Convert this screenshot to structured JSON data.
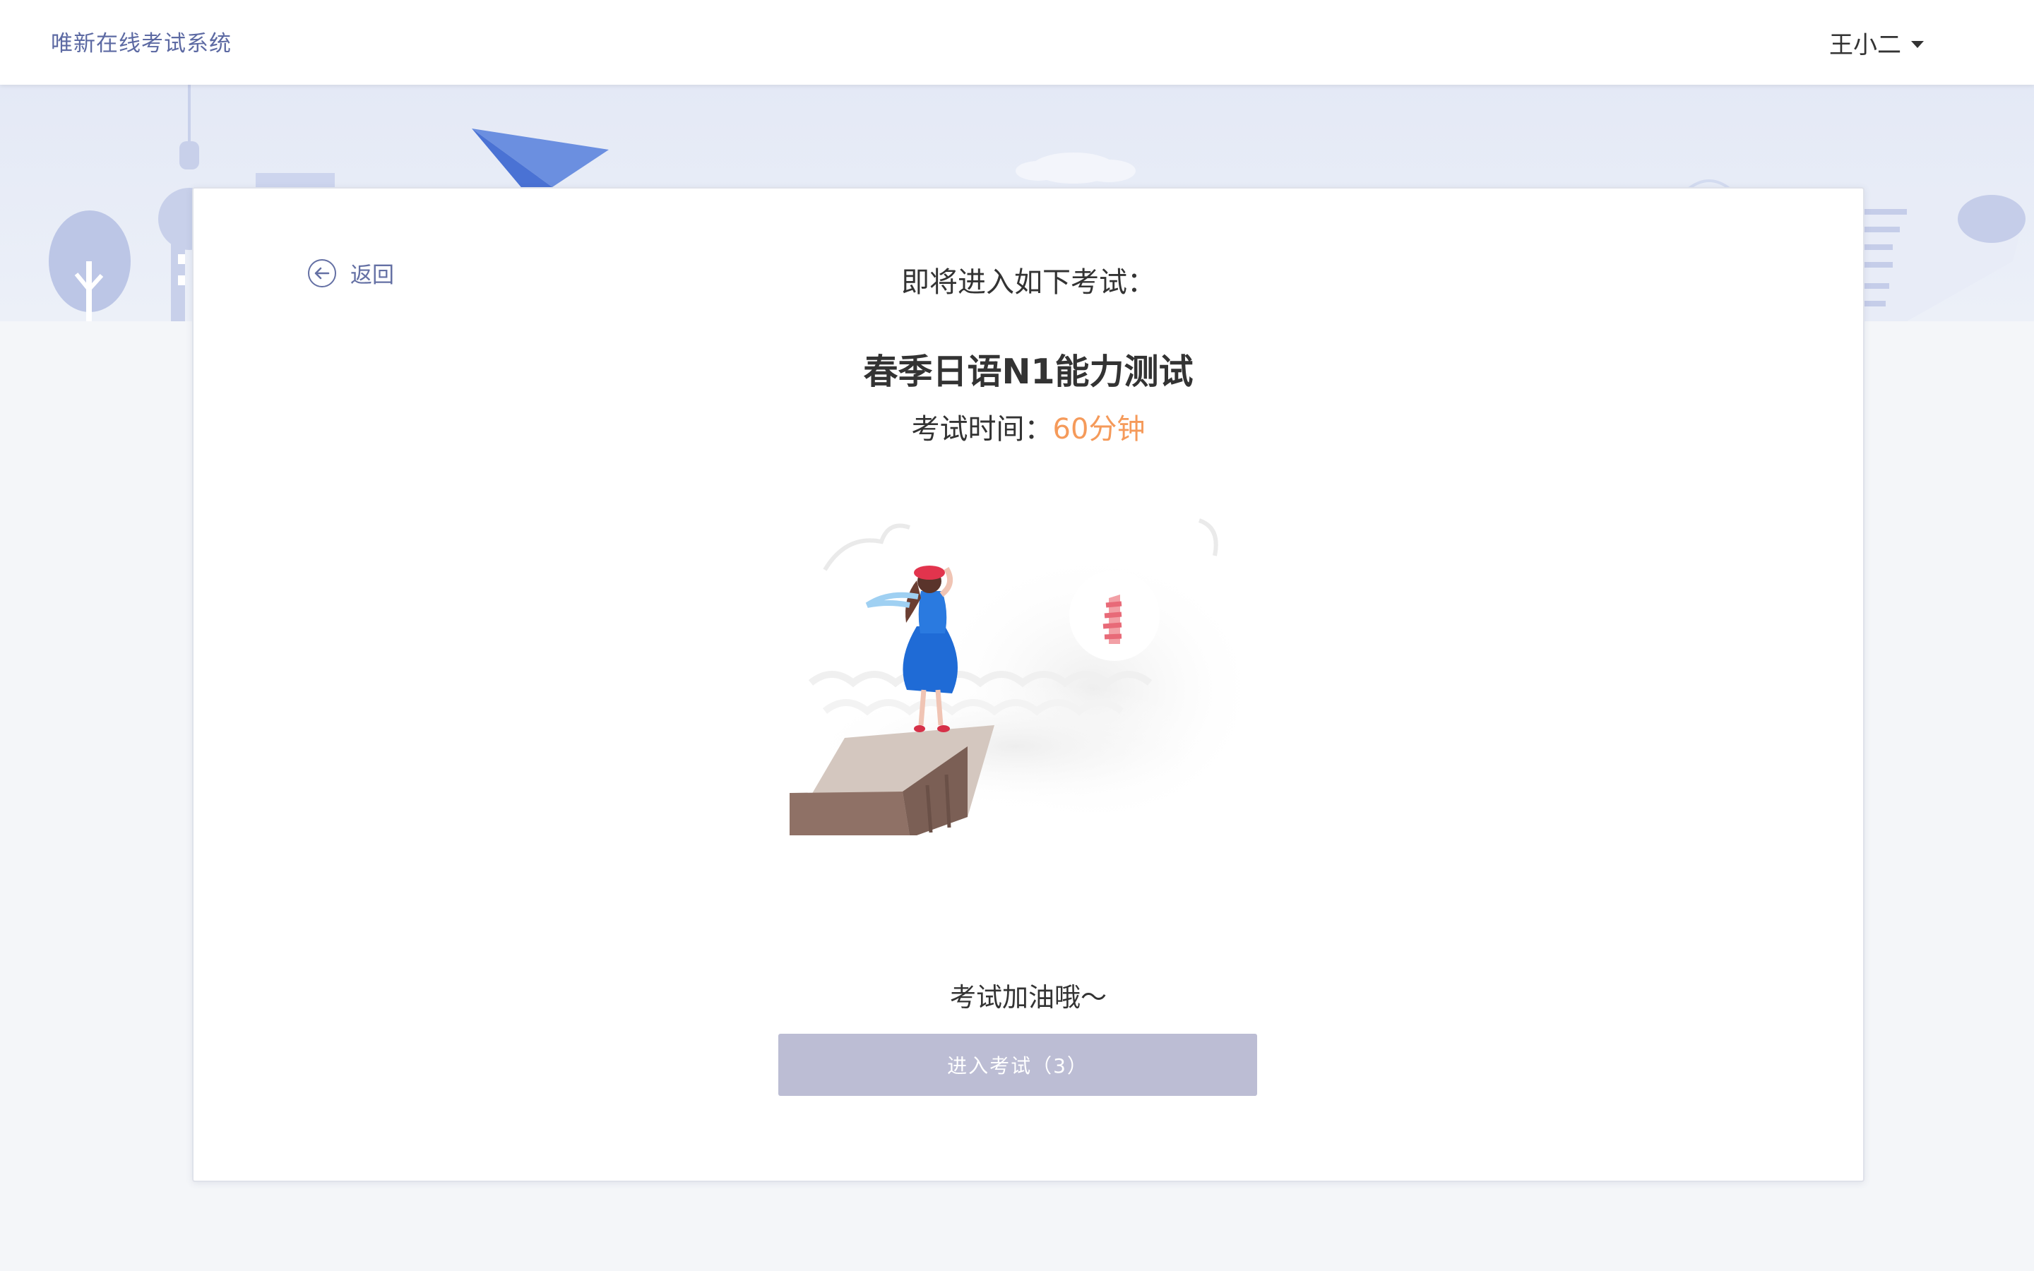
{
  "header": {
    "brand": "唯新在线考试系统",
    "user_name": "王小二"
  },
  "page": {
    "back_label": "返回",
    "lead_text": "即将进入如下考试：",
    "exam_title": "春季日语N1能力测试",
    "time_label": "考试时间：",
    "time_value": "60分钟",
    "cheer_text": "考试加油哦～",
    "enter_button_label": "进入考试（3）"
  },
  "colors": {
    "accent": "#5d6aa3",
    "time_highlight": "#f59a5a",
    "button_disabled": "#bcbdd4"
  },
  "icons": {
    "back": "arrow-left-circle-icon",
    "user_menu": "caret-down-icon"
  }
}
